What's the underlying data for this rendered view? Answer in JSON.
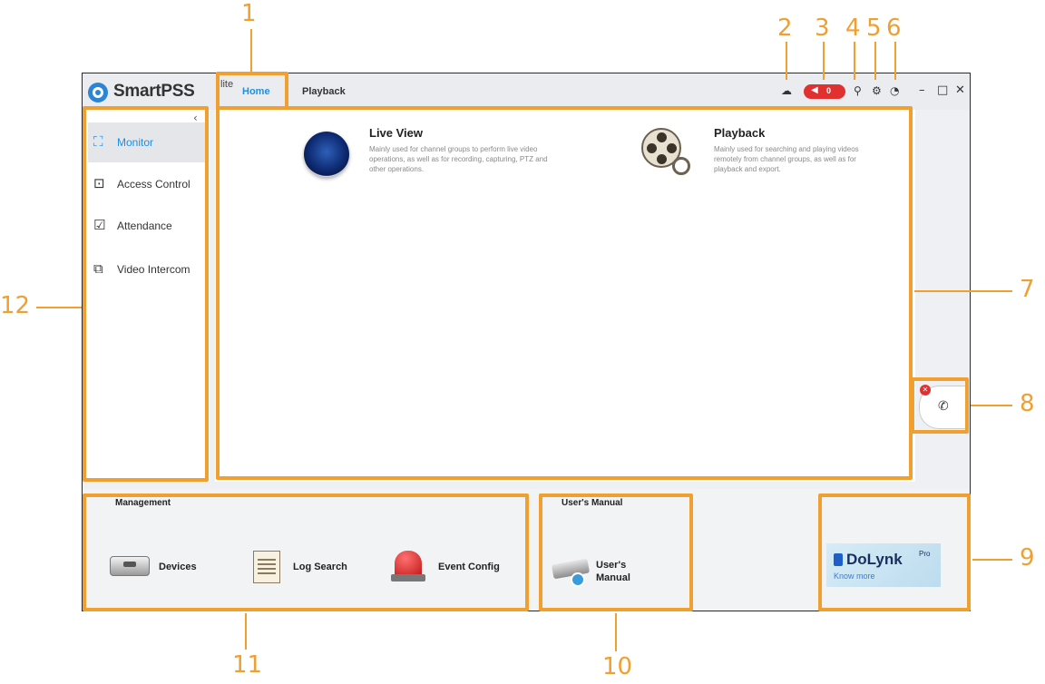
{
  "app": {
    "name": "SmartPSS",
    "edition": "lite"
  },
  "tabs": [
    {
      "label": "Home",
      "active": true
    },
    {
      "label": "Playback",
      "active": false
    }
  ],
  "toolbar": {
    "alarm_count": "0",
    "alarm_color": "#e03030"
  },
  "accent_color": "#1f8fe0",
  "callout_color": "#f0a030",
  "sidebar": {
    "items": [
      {
        "label": "Monitor",
        "icon": "monitor-icon",
        "active": true
      },
      {
        "label": "Access Control",
        "icon": "door-icon",
        "active": false
      },
      {
        "label": "Attendance",
        "icon": "calendar-check-icon",
        "active": false
      },
      {
        "label": "Video Intercom",
        "icon": "intercom-icon",
        "active": false
      }
    ]
  },
  "main": {
    "modules": [
      {
        "title": "Live View",
        "description": "Mainly used for channel groups to perform live video operations, as well as for recording, capturing, PTZ and other operations.",
        "icon": "live-view-icon"
      },
      {
        "title": "Playback",
        "description": "Mainly used for searching and playing videos remotely from channel groups, as well as for playback and export.",
        "icon": "film-reel-icon"
      }
    ]
  },
  "bottom": {
    "management": {
      "title": "Management",
      "items": [
        {
          "label": "Devices",
          "icon": "devices-icon"
        },
        {
          "label": "Log Search",
          "icon": "log-search-icon"
        },
        {
          "label": "Event Config",
          "icon": "event-alarm-icon"
        }
      ]
    },
    "manual": {
      "title": "User's Manual",
      "label_line1": "User's",
      "label_line2": "Manual",
      "icon": "camera-manual-icon"
    },
    "promo": {
      "brand": "DoLynk",
      "sup": "Pro",
      "link": "Know more"
    }
  },
  "callouts": [
    "1",
    "2",
    "3",
    "4",
    "5",
    "6",
    "7",
    "8",
    "9",
    "10",
    "11",
    "12"
  ]
}
